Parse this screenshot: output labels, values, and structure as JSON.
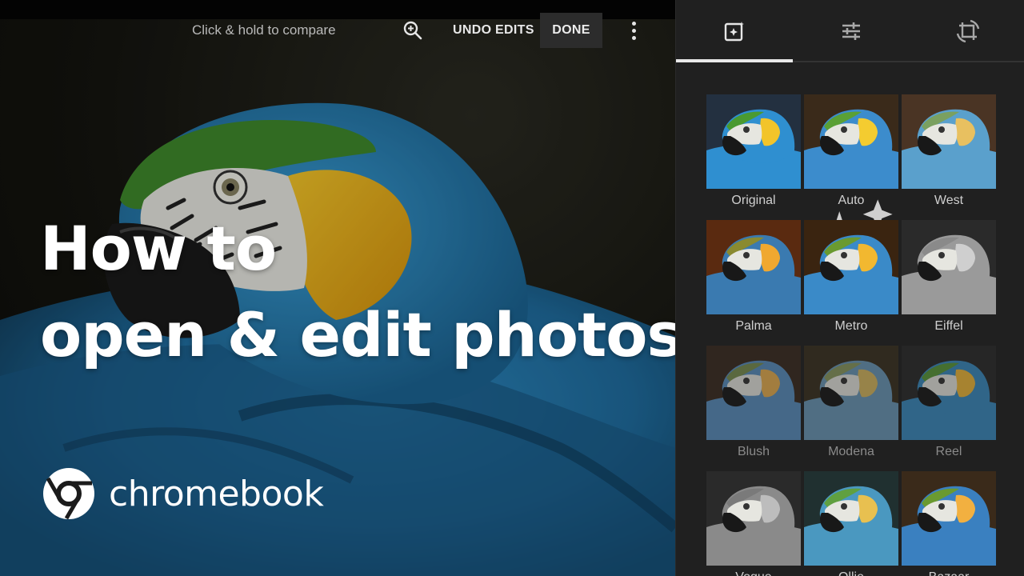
{
  "toolbar": {
    "hint": "Click & hold to compare",
    "zoom_icon": "zoom-in-icon",
    "undo_label": "UNDO EDITS",
    "done_label": "DONE",
    "more_icon": "more-vertical-icon"
  },
  "overlay": {
    "title_line1": "How to",
    "title_line2": "open & edit photos",
    "brand_name": "chromebook",
    "brand_icon": "chrome-logo-icon"
  },
  "panel": {
    "tabs": [
      {
        "icon": "auto-enhance-icon",
        "active": true
      },
      {
        "icon": "adjust-sliders-icon",
        "active": false
      },
      {
        "icon": "crop-rotate-icon",
        "active": false
      }
    ],
    "filters": [
      {
        "label": "Original",
        "icon": ""
      },
      {
        "label": "Auto",
        "icon": "sparkle-icon"
      },
      {
        "label": "West"
      },
      {
        "label": "Palma"
      },
      {
        "label": "Metro"
      },
      {
        "label": "Eiffel"
      },
      {
        "label": "Blush"
      },
      {
        "label": "Modena"
      },
      {
        "label": "Reel"
      },
      {
        "label": "Vogue"
      },
      {
        "label": "Ollie"
      },
      {
        "label": "Bazaar"
      }
    ]
  },
  "colors": {
    "panel_bg": "#202020",
    "accent": "#e8e8e8",
    "parrot_blue": "#2c7fb8",
    "parrot_yellow": "#f0b619",
    "parrot_green": "#3f8a2c"
  }
}
